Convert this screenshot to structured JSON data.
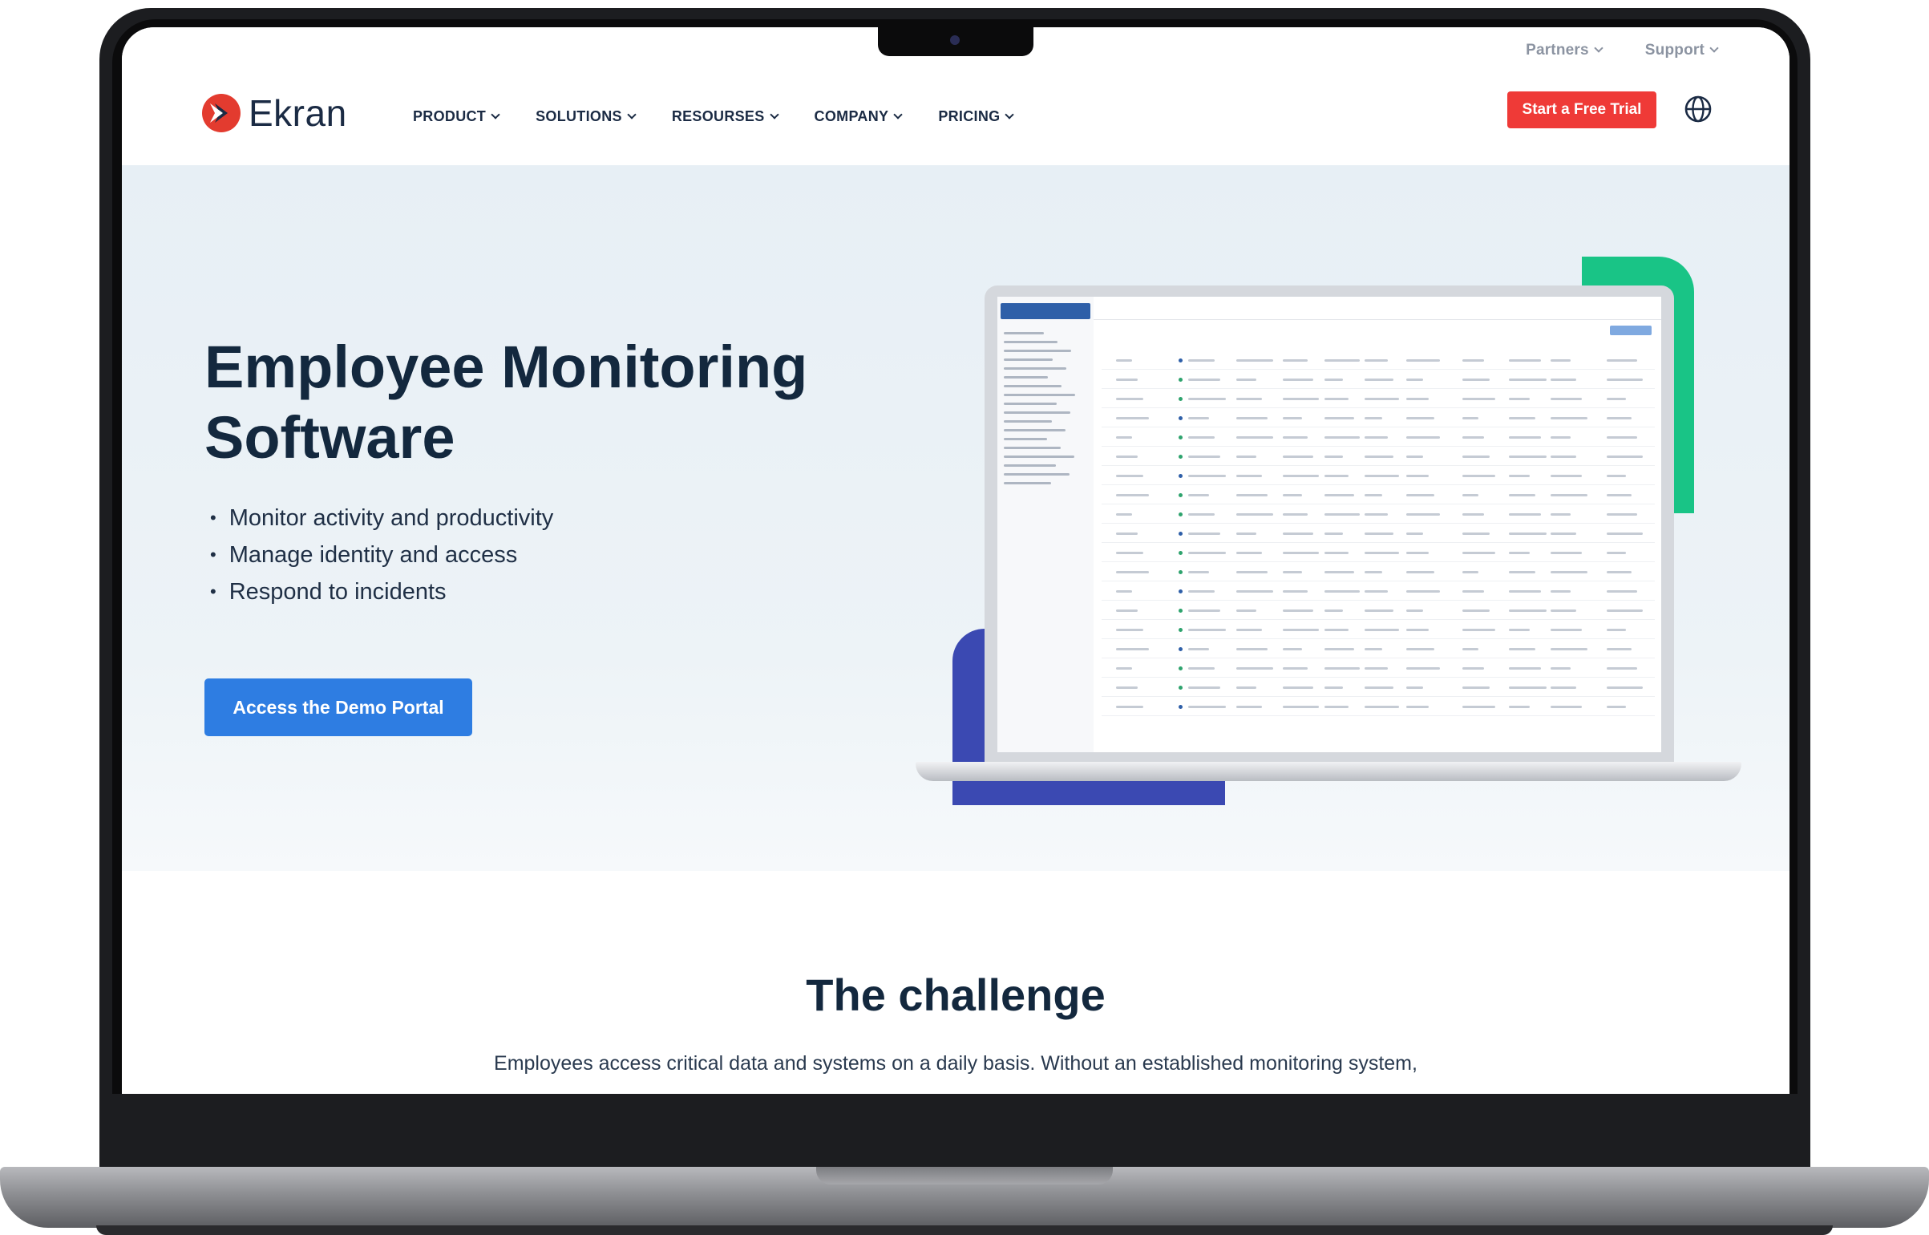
{
  "header": {
    "logo_text": "Ekran",
    "utility_links": [
      "Partners",
      "Support"
    ],
    "nav": [
      "PRODUCT",
      "SOLUTIONS",
      "RESOURSES",
      "COMPANY",
      "PRICING"
    ],
    "cta_label": "Start a Free Trial",
    "globe_icon": "globe-icon"
  },
  "hero": {
    "title_line1": "Employee Monitoring",
    "title_line2": "Software",
    "bullets": [
      "Monitor activity and productivity",
      "Manage identity and access",
      "Respond to incidents"
    ],
    "button_label": "Access the Demo Portal"
  },
  "challenge": {
    "title": "The challenge",
    "text": "Employees access critical data and systems on a daily basis. Without an established monitoring system,"
  },
  "colors": {
    "brand_red": "#ef3a37",
    "primary_blue": "#2e7de2",
    "accent_green": "#19c486",
    "accent_purple": "#3b49b2",
    "heading": "#13283e"
  }
}
